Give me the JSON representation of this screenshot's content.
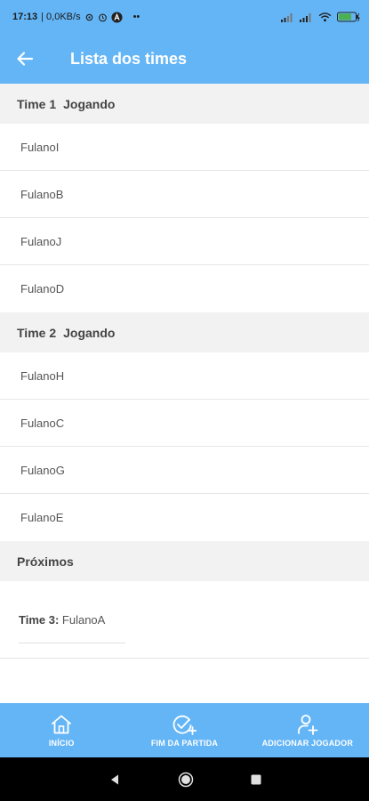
{
  "status_bar": {
    "time": "17:13",
    "speed": "| 0,0KB/s",
    "dots": "••",
    "battery_color": "#4caf50"
  },
  "toolbar": {
    "title": "Lista dos times",
    "back_icon": "arrow-left-icon"
  },
  "teams": [
    {
      "name": "Time 1",
      "status": "Jogando",
      "players": [
        "FulanoI",
        "FulanoB",
        "FulanoJ",
        "FulanoD"
      ]
    },
    {
      "name": "Time 2",
      "status": "Jogando",
      "players": [
        "FulanoH",
        "FulanoC",
        "FulanoG",
        "FulanoE"
      ]
    }
  ],
  "next": {
    "header": "Próximos",
    "label": "Time 3:",
    "value": "FulanoA"
  },
  "bottom_nav": {
    "items": [
      {
        "label": "INÍCIO",
        "icon": "home-icon"
      },
      {
        "label": "FIM DA PARTIDA",
        "icon": "check-circle-plus-icon"
      },
      {
        "label": "ADICIONAR JOGADOR",
        "icon": "person-add-icon"
      }
    ]
  },
  "colors": {
    "primary": "#64b5f6",
    "section_bg": "#f2f2f2"
  }
}
